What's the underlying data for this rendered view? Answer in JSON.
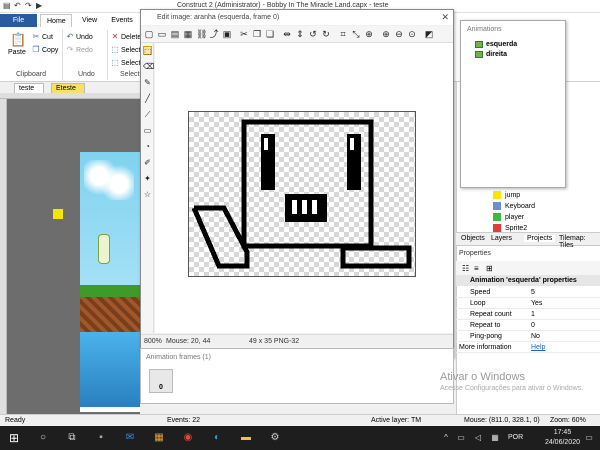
{
  "app": {
    "title": "Construct 2 (Administrator) - Bobby In The Miracle Land.capx - teste"
  },
  "ribbon": {
    "tabs": [
      "File",
      "Home",
      "View",
      "Events"
    ],
    "paste": "Paste",
    "cut": "Cut",
    "copy": "Copy",
    "undo": "Undo",
    "redo": "Redo",
    "delete": "Delete",
    "select_all": "Select",
    "select2": "Select",
    "groups": {
      "clipboard": "Clipboard",
      "undo": "Undo",
      "selection": "Selectio"
    }
  },
  "doc_tabs": [
    "teste",
    "Eteste"
  ],
  "editor": {
    "title": "Edit image: aranha (esquerda, frame 0)",
    "close": "✕",
    "status_zoom": "800%",
    "status_mouse": "Mouse: 20, 44",
    "status_size": "49 x 35  PNG-32"
  },
  "frames": {
    "title": "Animation frames (1)",
    "frame_index": "0"
  },
  "animations": {
    "title": "Animations",
    "items": [
      "esquerda",
      "direita"
    ]
  },
  "objects": {
    "items": [
      {
        "label": "jump",
        "color": "#f5e600"
      },
      {
        "label": "Keyboard",
        "color": "#6a8fcf"
      },
      {
        "label": "player",
        "color": "#3cba3c"
      },
      {
        "label": "Sprite2",
        "color": "#e03c3c"
      }
    ]
  },
  "panel_tabs": [
    "Objects",
    "Layers",
    "Projects",
    "Tilemap: Tiles"
  ],
  "properties": {
    "header": "Properties",
    "section": "Animation 'esquerda' properties",
    "rows": [
      {
        "k": "Speed",
        "v": "5"
      },
      {
        "k": "Loop",
        "v": "Yes"
      },
      {
        "k": "Repeat count",
        "v": "1"
      },
      {
        "k": "Repeat to",
        "v": "0"
      },
      {
        "k": "Ping-pong",
        "v": "No"
      },
      {
        "k": "More information",
        "v": "Help"
      }
    ]
  },
  "status": {
    "ready": "Ready",
    "events": "Events: 22",
    "layer": "Active layer: TM",
    "mouse": "Mouse: (811.0, 328.1, 0)",
    "zoom": "Zoom: 60%"
  },
  "watermark": {
    "line1": "Ativar o Windows",
    "line2": "Acesse Configurações para ativar o Windows."
  },
  "taskbar": {
    "lang": "POR",
    "time": "17:45",
    "date": "24/06/2020"
  }
}
